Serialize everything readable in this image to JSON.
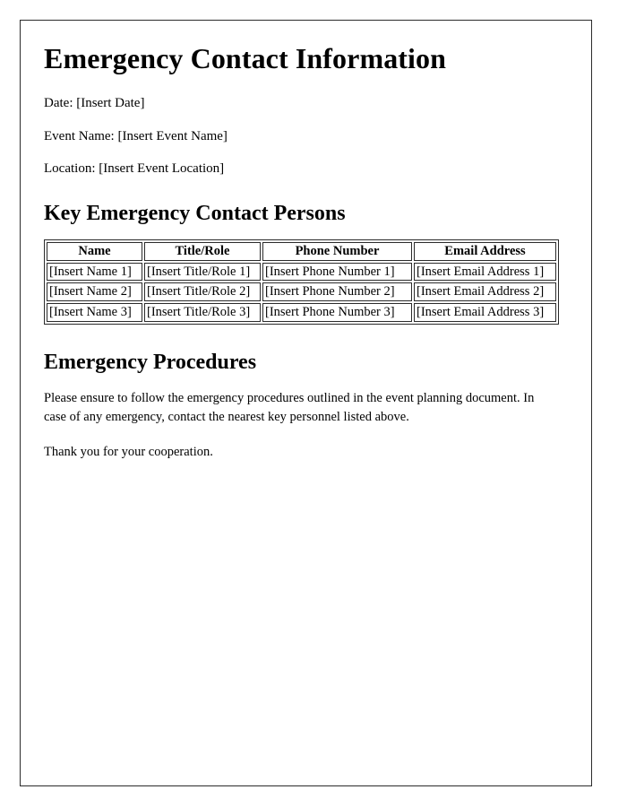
{
  "document": {
    "title": "Emergency Contact Information",
    "meta": [
      {
        "label": "Date:",
        "value": "[Insert Date]",
        "text": "Date: [Insert Date]"
      },
      {
        "label": "Event Name:",
        "value": "[Insert Event Name]",
        "text": "Event Name: [Insert Event Name]"
      },
      {
        "label": "Location:",
        "value": "[Insert Event Location]",
        "text": "Location: [Insert Event Location]"
      }
    ],
    "contacts_section": {
      "heading": "Key Emergency Contact Persons",
      "table": {
        "columns": [
          "Name",
          "Title/Role",
          "Phone Number",
          "Email Address"
        ],
        "rows": [
          [
            "[Insert Name 1]",
            "[Insert Title/Role 1]",
            "[Insert Phone Number 1]",
            "[Insert Email Address 1]"
          ],
          [
            "[Insert Name 2]",
            "[Insert Title/Role 2]",
            "[Insert Phone Number 2]",
            "[Insert Email Address 2]"
          ],
          [
            "[Insert Name 3]",
            "[Insert Title/Role 3]",
            "[Insert Phone Number 3]",
            "[Insert Email Address 3]"
          ]
        ]
      }
    },
    "procedures_section": {
      "heading": "Emergency Procedures",
      "paragraph": "Please ensure to follow the emergency procedures outlined in the event planning document. In case of any emergency, contact the nearest key personnel listed above.",
      "closing": "Thank you for your cooperation."
    }
  },
  "style": {
    "page_background": "#ffffff",
    "text_color": "#000000",
    "border_color": "#2b2b2b"
  }
}
